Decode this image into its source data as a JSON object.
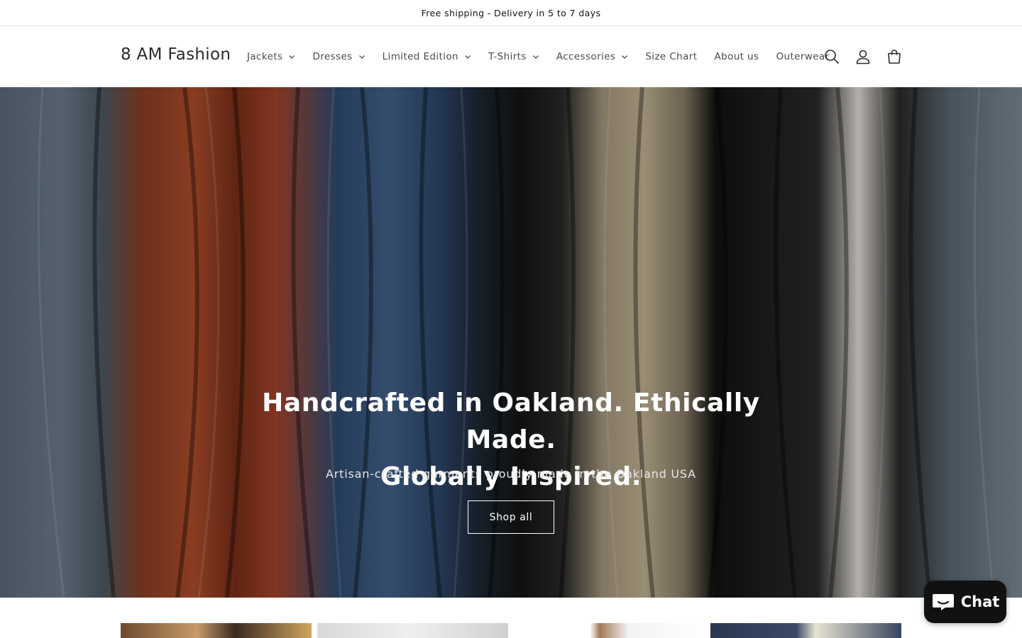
{
  "announcement": {
    "text": "Free shipping - Delivery in 5 to 7 days"
  },
  "header": {
    "logo": "8 AM Fashion",
    "nav": [
      {
        "label": "Jackets",
        "dropdown": true
      },
      {
        "label": "Dresses",
        "dropdown": true
      },
      {
        "label": "Limited Edition",
        "dropdown": true
      },
      {
        "label": "T-Shirts",
        "dropdown": true
      },
      {
        "label": "Accessories",
        "dropdown": true
      },
      {
        "label": "Size Chart",
        "dropdown": false
      },
      {
        "label": "About us",
        "dropdown": false
      },
      {
        "label": "Outerwear",
        "dropdown": false
      }
    ],
    "icons": [
      "search-icon",
      "account-icon",
      "cart-icon"
    ]
  },
  "hero": {
    "title_line1": "Handcrafted in Oakland. Ethically Made.",
    "title_line2": "Globally Inspired.",
    "subtitle": "Artisan-crafted garments proudly made in the Oakland USA",
    "button": "Shop all"
  },
  "chat": {
    "label": "Chat",
    "icon": "chat-bubble-icon"
  },
  "colors": {
    "text": "#121212",
    "chat_bg": "#111111",
    "border": "#e6e6e6"
  }
}
